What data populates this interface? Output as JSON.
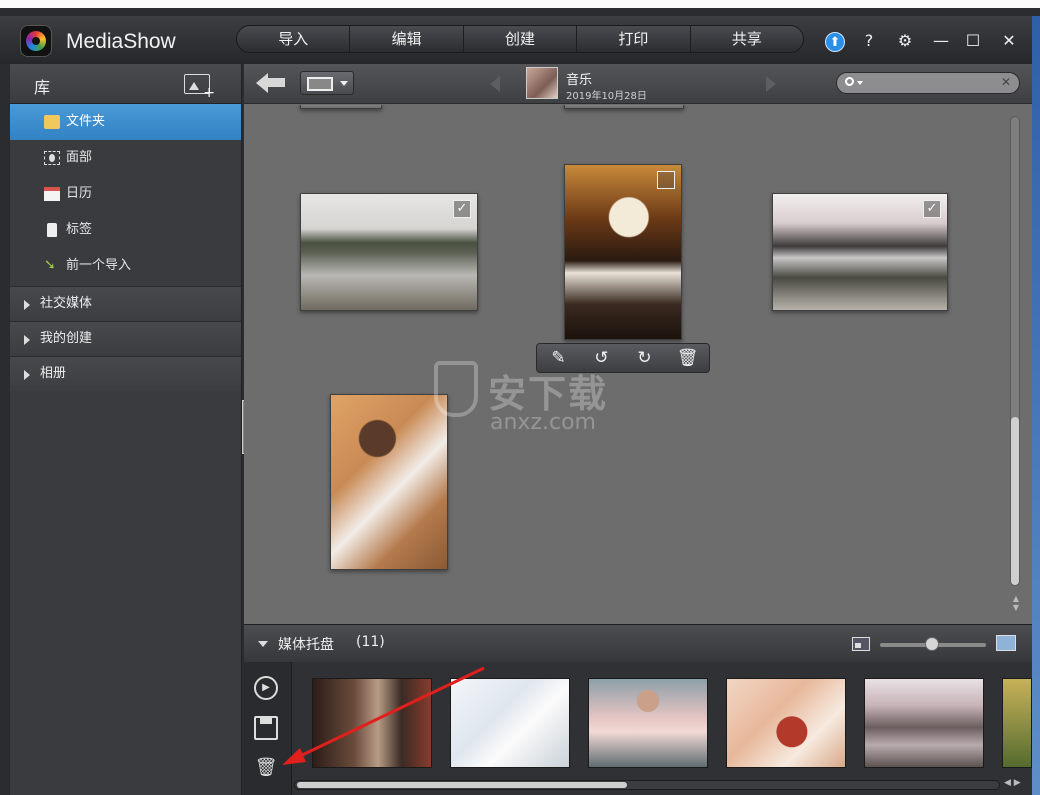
{
  "app": {
    "title": "MediaShow"
  },
  "menu": {
    "items": [
      "导入",
      "编辑",
      "创建",
      "打印",
      "共享"
    ]
  },
  "window_buttons": {
    "help": "?",
    "settings": "⚙",
    "minimize": "—",
    "maximize": "☐",
    "close": "✕"
  },
  "sidebar": {
    "title": "库",
    "items": [
      {
        "label": "文件夹",
        "icon": "folder-icon",
        "active": true
      },
      {
        "label": "面部",
        "icon": "face-icon"
      },
      {
        "label": "日历",
        "icon": "calendar-icon"
      },
      {
        "label": "标签",
        "icon": "tag-icon"
      },
      {
        "label": "前一个导入",
        "icon": "import-arrow-icon"
      }
    ],
    "sections": [
      "社交媒体",
      "我的创建",
      "相册"
    ]
  },
  "album": {
    "name": "音乐",
    "date": "2019年10月28日"
  },
  "search": {
    "placeholder": "",
    "value": ""
  },
  "photos": [
    {
      "name": "lake-reflection",
      "checked": true
    },
    {
      "name": "woman-orange",
      "checked": false
    },
    {
      "name": "cherry-bridge",
      "checked": true
    },
    {
      "name": "woman-white-robe",
      "checked": false
    }
  ],
  "watermark": {
    "cn": "安下载",
    "en": "anxz.com"
  },
  "tray": {
    "title": "媒体托盘",
    "count": "(11)"
  },
  "colors": {
    "accent": "#3a8fd2",
    "arrow": "#e0201c"
  }
}
